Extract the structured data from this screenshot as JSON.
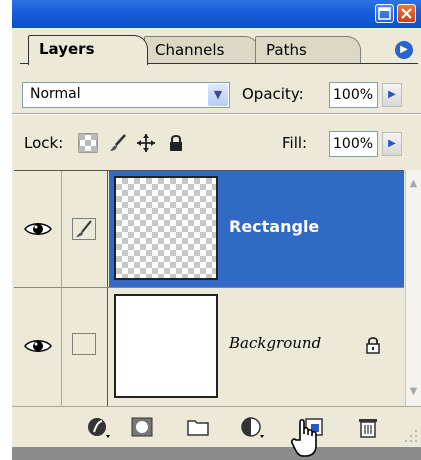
{
  "tabs": [
    {
      "label": "Layers",
      "active": true
    },
    {
      "label": "Channels",
      "active": false
    },
    {
      "label": "Paths",
      "active": false
    }
  ],
  "blend_mode": {
    "selected": "Normal"
  },
  "opacity": {
    "label": "Opacity:",
    "value": "100%"
  },
  "lock": {
    "label": "Lock:"
  },
  "fill": {
    "label": "Fill:",
    "value": "100%"
  },
  "layers": [
    {
      "name": "Rectangle",
      "visible": true,
      "selected": true,
      "thumbnail": "transparent",
      "linked": "brush-icon"
    },
    {
      "name": "Background",
      "visible": true,
      "selected": false,
      "thumbnail": "white",
      "locked": true
    }
  ],
  "colors": {
    "selection": "#316ac5",
    "panel": "#ece9d8",
    "titlebar": "#1a5fd9"
  },
  "bottom_toolbar": [
    "add-layer-style-icon",
    "add-mask-icon",
    "new-group-icon",
    "adjustment-layer-icon",
    "new-layer-icon",
    "trash-icon"
  ]
}
